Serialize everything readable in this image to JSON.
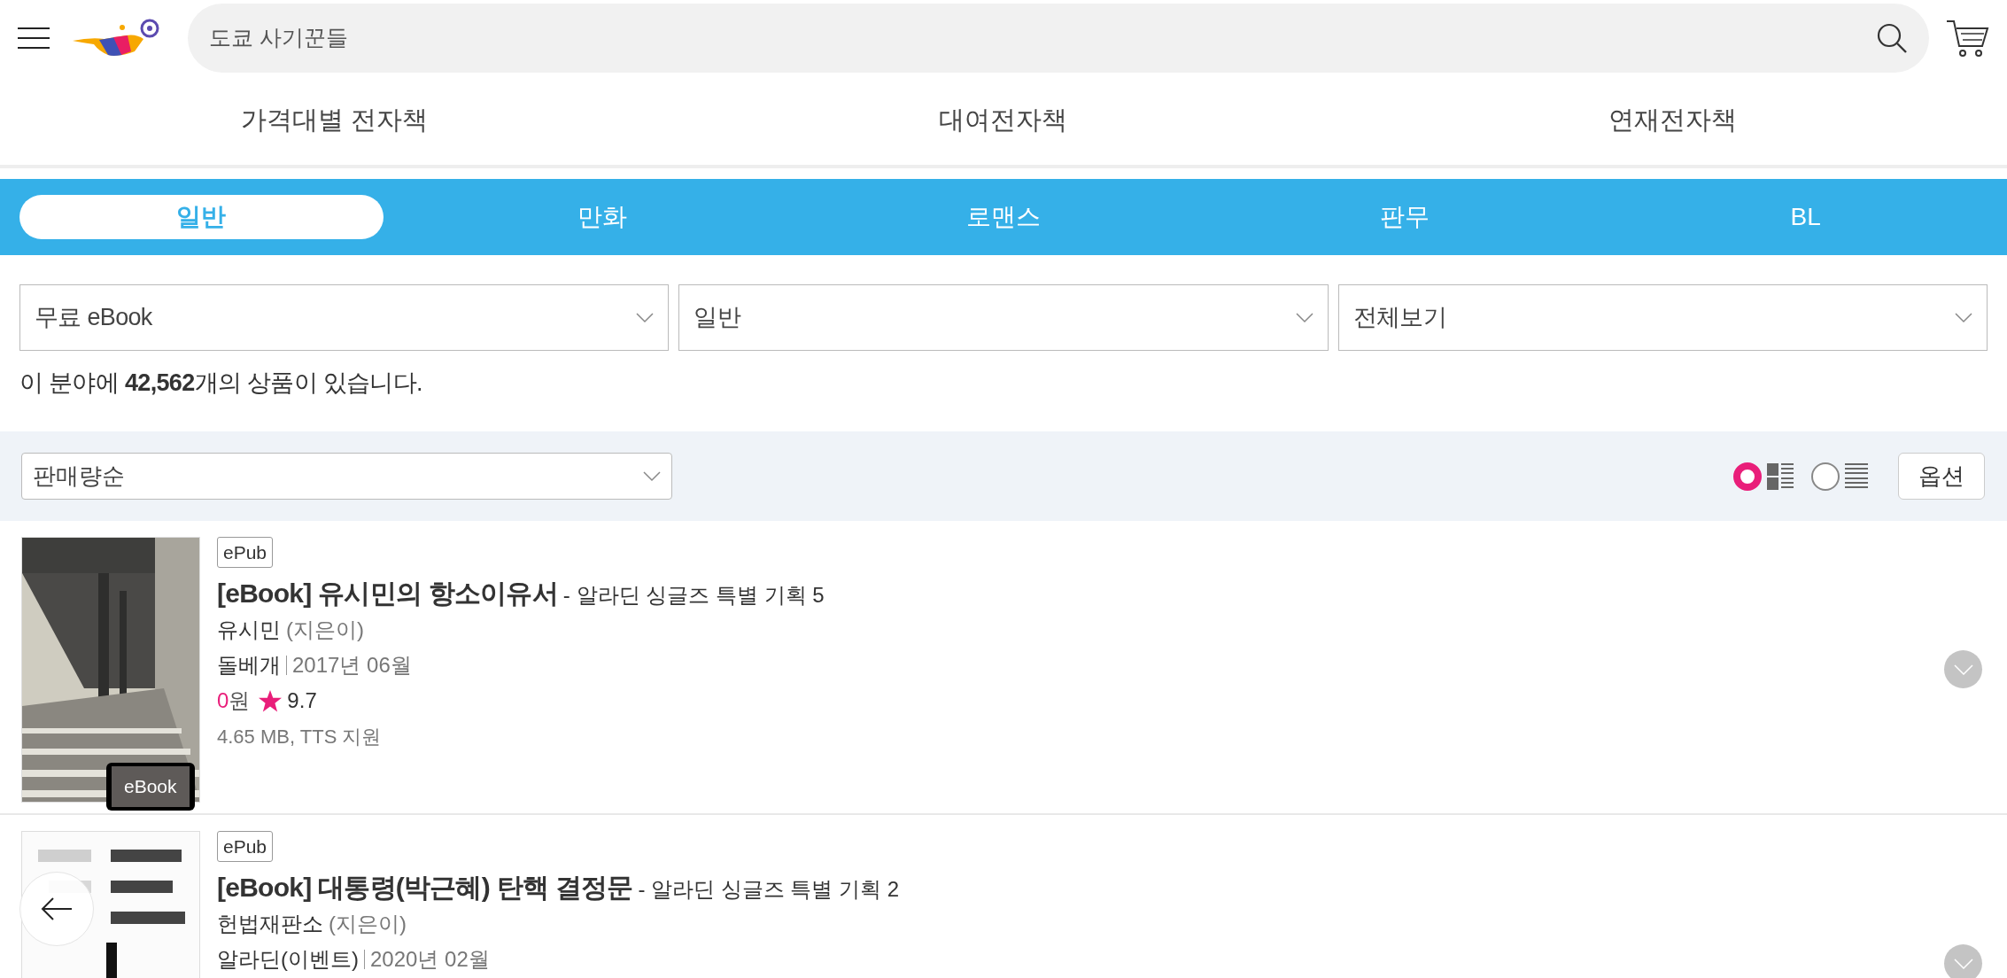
{
  "header": {
    "search": {
      "value": "도쿄 사기꾼들"
    }
  },
  "nav_links": [
    "가격대별 전자책",
    "대여전자책",
    "연재전자책"
  ],
  "category_tabs": [
    {
      "label": "일반",
      "selected": true
    },
    {
      "label": "만화",
      "selected": false
    },
    {
      "label": "로맨스",
      "selected": false
    },
    {
      "label": "판무",
      "selected": false
    },
    {
      "label": "BL",
      "selected": false
    }
  ],
  "filters": [
    {
      "value": "무료 eBook"
    },
    {
      "value": "일반"
    },
    {
      "value": "전체보기"
    }
  ],
  "result_count": "이 분야에 **42,562**개의 상품이 있습니다.",
  "sort": {
    "value": "판매량순"
  },
  "view_modes": [
    {
      "kind": "grid",
      "selected": true
    },
    {
      "kind": "list",
      "selected": false
    }
  ],
  "option_button": "옵션",
  "books": [
    {
      "cover_badge": "eBook",
      "format": "ePub",
      "title": "[eBook] 유시민의 항소이유서",
      "subtitle": "- 알라딘 싱글즈 특별 기획 5",
      "author": "유시민",
      "role": "(지은이)",
      "publisher": "돌베개",
      "date": "2017년 06월",
      "price": "0",
      "currency": "원",
      "rating": "9.7",
      "info": "4.65 MB, TTS 지원"
    },
    {
      "format": "ePub",
      "title": "[eBook] 대통령(박근혜) 탄핵 결정문",
      "subtitle": "- 알라딘 싱글즈 특별 기획 2",
      "author": "헌법재판소",
      "role": "(지은이)",
      "publisher": "알라딘(이벤트)",
      "date": "2020년 02월"
    }
  ]
}
